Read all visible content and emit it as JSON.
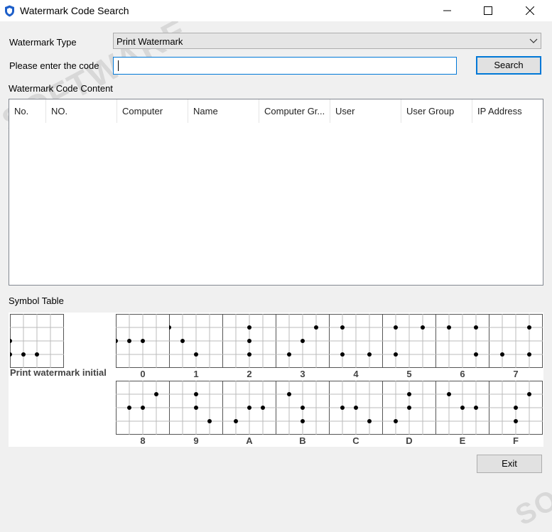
{
  "window": {
    "title": "Watermark Code Search",
    "controls": {
      "minimize": "—",
      "maximize": "☐",
      "close": "✕"
    }
  },
  "form": {
    "watermark_type_label": "Watermark Type",
    "watermark_type_value": "Print Watermark",
    "code_label": "Please enter the code",
    "code_value": "",
    "search_button": "Search"
  },
  "content": {
    "section_label": "Watermark Code Content",
    "columns": [
      "No.",
      "NO.",
      "Computer",
      "Name",
      "Computer Gr...",
      "User",
      "User Group",
      "IP Address"
    ],
    "rows": []
  },
  "symbols": {
    "section_label": "Symbol Table",
    "initial_label": "Print watermark initial",
    "initial_dots": [
      [
        0,
        1
      ],
      [
        0,
        2
      ],
      [
        1,
        2
      ],
      [
        2,
        2
      ]
    ],
    "items": [
      {
        "label": "0",
        "dots": [
          [
            0,
            1
          ],
          [
            1,
            1
          ],
          [
            2,
            1
          ]
        ]
      },
      {
        "label": "1",
        "dots": [
          [
            0,
            0
          ],
          [
            1,
            1
          ],
          [
            2,
            2
          ]
        ]
      },
      {
        "label": "2",
        "dots": [
          [
            2,
            0
          ],
          [
            2,
            1
          ],
          [
            2,
            2
          ]
        ]
      },
      {
        "label": "3",
        "dots": [
          [
            3,
            0
          ],
          [
            2,
            1
          ],
          [
            1,
            2
          ]
        ]
      },
      {
        "label": "4",
        "dots": [
          [
            1,
            0
          ],
          [
            1,
            2
          ],
          [
            3,
            2
          ]
        ]
      },
      {
        "label": "5",
        "dots": [
          [
            1,
            0
          ],
          [
            3,
            0
          ],
          [
            1,
            2
          ]
        ]
      },
      {
        "label": "6",
        "dots": [
          [
            1,
            0
          ],
          [
            3,
            0
          ],
          [
            3,
            2
          ]
        ]
      },
      {
        "label": "7",
        "dots": [
          [
            3,
            0
          ],
          [
            1,
            2
          ],
          [
            3,
            2
          ]
        ]
      },
      {
        "label": "8",
        "dots": [
          [
            3,
            0
          ],
          [
            1,
            1
          ],
          [
            2,
            1
          ]
        ]
      },
      {
        "label": "9",
        "dots": [
          [
            2,
            0
          ],
          [
            2,
            1
          ],
          [
            3,
            2
          ]
        ]
      },
      {
        "label": "A",
        "dots": [
          [
            2,
            1
          ],
          [
            3,
            1
          ],
          [
            1,
            2
          ]
        ]
      },
      {
        "label": "B",
        "dots": [
          [
            1,
            0
          ],
          [
            2,
            1
          ],
          [
            2,
            2
          ]
        ]
      },
      {
        "label": "C",
        "dots": [
          [
            1,
            1
          ],
          [
            2,
            1
          ],
          [
            3,
            2
          ]
        ]
      },
      {
        "label": "D",
        "dots": [
          [
            2,
            0
          ],
          [
            2,
            1
          ],
          [
            1,
            2
          ]
        ]
      },
      {
        "label": "E",
        "dots": [
          [
            1,
            0
          ],
          [
            2,
            1
          ],
          [
            3,
            1
          ]
        ]
      },
      {
        "label": "F",
        "dots": [
          [
            3,
            0
          ],
          [
            2,
            1
          ],
          [
            2,
            2
          ]
        ]
      }
    ]
  },
  "footer": {
    "exit_button": "Exit"
  },
  "watermark_text": "SOFTWARE"
}
